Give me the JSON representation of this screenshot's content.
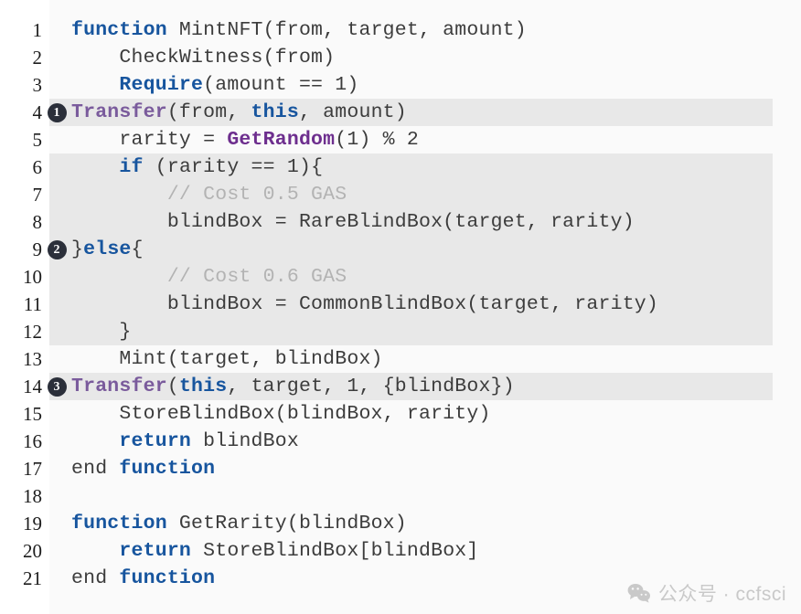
{
  "figure": {
    "kind": "code-listing",
    "language": "pseudocode",
    "background": "#fafafa",
    "highlight_color": "#e8e8e8",
    "colors": {
      "keyword": "#17559e",
      "function_purple_muted": "#7a5b9c",
      "function_purple": "#6d2e8e",
      "comment": "#b3b3b3",
      "plain": "#3c3c3c",
      "badge_bg": "#2b2f3a",
      "line_number": "#1c1c1c"
    }
  },
  "lines": [
    {
      "number": "1",
      "badge": "",
      "highlight": false,
      "tokens": [
        {
          "t": "function",
          "c": "kw"
        },
        {
          "t": " MintNFT(from, target, amount)",
          "c": "pl"
        }
      ]
    },
    {
      "number": "2",
      "badge": "",
      "highlight": false,
      "tokens": [
        {
          "t": "    CheckWitness(from)",
          "c": "pl"
        }
      ]
    },
    {
      "number": "3",
      "badge": "",
      "highlight": false,
      "tokens": [
        {
          "t": "    ",
          "c": "pl"
        },
        {
          "t": "Require",
          "c": "kw"
        },
        {
          "t": "(amount == 1)",
          "c": "pl"
        }
      ]
    },
    {
      "number": "4",
      "badge": "❶",
      "highlight": true,
      "tokens": [
        {
          "t": "Transfer",
          "c": "fn"
        },
        {
          "t": "(from, ",
          "c": "pl"
        },
        {
          "t": "this",
          "c": "kw"
        },
        {
          "t": ", amount)",
          "c": "pl"
        }
      ]
    },
    {
      "number": "5",
      "badge": "",
      "highlight": false,
      "tokens": [
        {
          "t": "    rarity = ",
          "c": "pl"
        },
        {
          "t": "GetRandom",
          "c": "fn2"
        },
        {
          "t": "(1) % 2",
          "c": "pl"
        }
      ]
    },
    {
      "number": "6",
      "badge": "",
      "highlight": true,
      "tokens": [
        {
          "t": "    ",
          "c": "pl"
        },
        {
          "t": "if",
          "c": "kw"
        },
        {
          "t": " (rarity == 1){",
          "c": "pl"
        }
      ]
    },
    {
      "number": "7",
      "badge": "",
      "highlight": true,
      "tokens": [
        {
          "t": "        // Cost 0.5 GAS",
          "c": "com"
        }
      ]
    },
    {
      "number": "8",
      "badge": "",
      "highlight": true,
      "tokens": [
        {
          "t": "        blindBox = RareBlindBox(target, rarity)",
          "c": "pl"
        }
      ]
    },
    {
      "number": "9",
      "badge": "❷",
      "highlight": true,
      "tokens": [
        {
          "t": "}",
          "c": "pl"
        },
        {
          "t": "else",
          "c": "kw"
        },
        {
          "t": "{",
          "c": "pl"
        }
      ]
    },
    {
      "number": "10",
      "badge": "",
      "highlight": true,
      "tokens": [
        {
          "t": "        // Cost 0.6 GAS",
          "c": "com"
        }
      ]
    },
    {
      "number": "11",
      "badge": "",
      "highlight": true,
      "tokens": [
        {
          "t": "        blindBox = CommonBlindBox(target, rarity)",
          "c": "pl"
        }
      ]
    },
    {
      "number": "12",
      "badge": "",
      "highlight": true,
      "tokens": [
        {
          "t": "    }",
          "c": "pl"
        }
      ]
    },
    {
      "number": "13",
      "badge": "",
      "highlight": false,
      "tokens": [
        {
          "t": "    Mint(target, blindBox)",
          "c": "pl"
        }
      ]
    },
    {
      "number": "14",
      "badge": "❸",
      "highlight": true,
      "tokens": [
        {
          "t": "Transfer",
          "c": "fn"
        },
        {
          "t": "(",
          "c": "pl"
        },
        {
          "t": "this",
          "c": "kw"
        },
        {
          "t": ", target, 1, {blindBox})",
          "c": "pl"
        }
      ]
    },
    {
      "number": "15",
      "badge": "",
      "highlight": false,
      "tokens": [
        {
          "t": "    StoreBlindBox(blindBox, rarity)",
          "c": "pl"
        }
      ]
    },
    {
      "number": "16",
      "badge": "",
      "highlight": false,
      "tokens": [
        {
          "t": "    ",
          "c": "pl"
        },
        {
          "t": "return",
          "c": "kw"
        },
        {
          "t": " blindBox",
          "c": "pl"
        }
      ]
    },
    {
      "number": "17",
      "badge": "",
      "highlight": false,
      "tokens": [
        {
          "t": "end ",
          "c": "pl"
        },
        {
          "t": "function",
          "c": "kw"
        }
      ]
    },
    {
      "number": "18",
      "badge": "",
      "highlight": false,
      "tokens": [
        {
          "t": "",
          "c": "pl"
        }
      ]
    },
    {
      "number": "19",
      "badge": "",
      "highlight": false,
      "tokens": [
        {
          "t": "function",
          "c": "kw"
        },
        {
          "t": " GetRarity(blindBox)",
          "c": "pl"
        }
      ]
    },
    {
      "number": "20",
      "badge": "",
      "highlight": false,
      "tokens": [
        {
          "t": "    ",
          "c": "pl"
        },
        {
          "t": "return",
          "c": "kw"
        },
        {
          "t": " StoreBlindBox[blindBox]",
          "c": "pl"
        }
      ]
    },
    {
      "number": "21",
      "badge": "",
      "highlight": false,
      "tokens": [
        {
          "t": "end ",
          "c": "pl"
        },
        {
          "t": "function",
          "c": "kw"
        }
      ]
    }
  ],
  "watermark": {
    "icon": "wechat-icon",
    "text": "公众号 · ccfsci"
  }
}
